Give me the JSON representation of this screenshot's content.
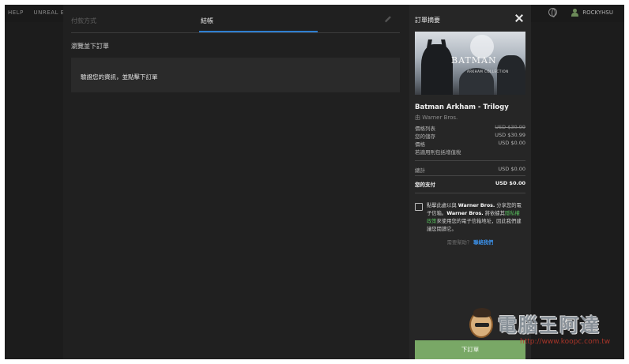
{
  "topnav": {
    "items": [
      "HELP",
      "UNREAL ENG"
    ],
    "username": "ROCKYHSU"
  },
  "checkout": {
    "tabs": [
      {
        "label": "付款方式",
        "active": false
      },
      {
        "label": "結帳",
        "active": true
      }
    ],
    "section_title": "瀏覽並下訂單",
    "info_text": "驗證您的資訊，並點擊下訂單"
  },
  "summary": {
    "title": "訂單摘要",
    "cover": {
      "logo": "BATMAN",
      "subtitle": "ARKHAM COLLECTION"
    },
    "game_title": "Batman Arkham - Trilogy",
    "publisher": "由 Warner Bros.",
    "rows": [
      {
        "label": "價格列表",
        "value": "USD $30.99"
      },
      {
        "label": "您的儲存",
        "value": "USD $30.99"
      },
      {
        "label": "價格",
        "value": "USD $0.00"
      },
      {
        "label": "若適用則包括增值稅",
        "value": ""
      }
    ],
    "subtotal_label": "總計",
    "subtotal_value": "USD $0.00",
    "total_label": "您的支付",
    "total_value": "USD $0.00",
    "consent": {
      "part1": "點擊此處以與 ",
      "bold1": "Warner Bros.",
      "part2": " 分享您的電子信箱。",
      "bold2": "Warner Bros.",
      "part3": " 將依據其",
      "link": "隱私權政策",
      "part4": "來使用您的電子信箱地址，因此我們建議您閱讀它。"
    },
    "help_text": "需要幫助？",
    "help_link": "聯絡我們",
    "place_order": "下訂單"
  },
  "watermark": {
    "title": "電腦王阿達",
    "url": "http://www.koopc.com.tw"
  },
  "colors": {
    "accent_blue": "#2f7fd1",
    "button_green": "#79a866",
    "link_green": "#55b75a",
    "link_blue": "#3b8fe6"
  }
}
